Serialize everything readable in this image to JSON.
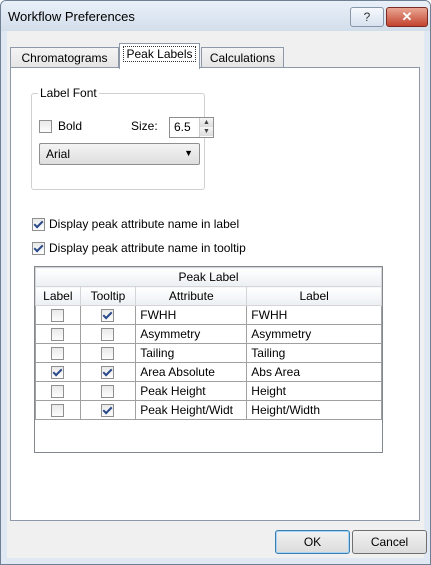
{
  "window": {
    "title": "Workflow Preferences",
    "help_label": "?",
    "close_label": "✕"
  },
  "tabs": [
    {
      "label": "Chromatograms",
      "active": false
    },
    {
      "label": "Peak Labels",
      "active": true
    },
    {
      "label": "Calculations",
      "active": false
    }
  ],
  "label_font": {
    "legend": "Label Font",
    "bold_label": "Bold",
    "bold_checked": false,
    "size_label": "Size:",
    "size_value": "6.5",
    "font_value": "Arial"
  },
  "options": {
    "display_in_label": "Display peak attribute name in label",
    "display_in_label_checked": true,
    "display_in_tooltip": "Display peak attribute name in tooltip",
    "display_in_tooltip_checked": true
  },
  "grid": {
    "group_header": "Peak Label",
    "columns": [
      "Label",
      "Tooltip",
      "Attribute",
      "Label"
    ],
    "rows": [
      {
        "label": false,
        "tooltip": true,
        "attribute": "FWHH",
        "display": "FWHH"
      },
      {
        "label": false,
        "tooltip": false,
        "attribute": "Asymmetry",
        "display": "Asymmetry"
      },
      {
        "label": false,
        "tooltip": false,
        "attribute": "Tailing",
        "display": "Tailing"
      },
      {
        "label": true,
        "tooltip": true,
        "attribute": "Area Absolute",
        "display": "Abs Area"
      },
      {
        "label": false,
        "tooltip": false,
        "attribute": "Peak Height",
        "display": "Height"
      },
      {
        "label": false,
        "tooltip": true,
        "attribute": "Peak Height/Widt",
        "display": "Height/Width"
      }
    ]
  },
  "buttons": {
    "ok": "OK",
    "cancel": "Cancel"
  },
  "colors": {
    "title_bg": "#dfe8f3",
    "close_red": "#c2432f",
    "check_mark": "#2b4a8a"
  }
}
